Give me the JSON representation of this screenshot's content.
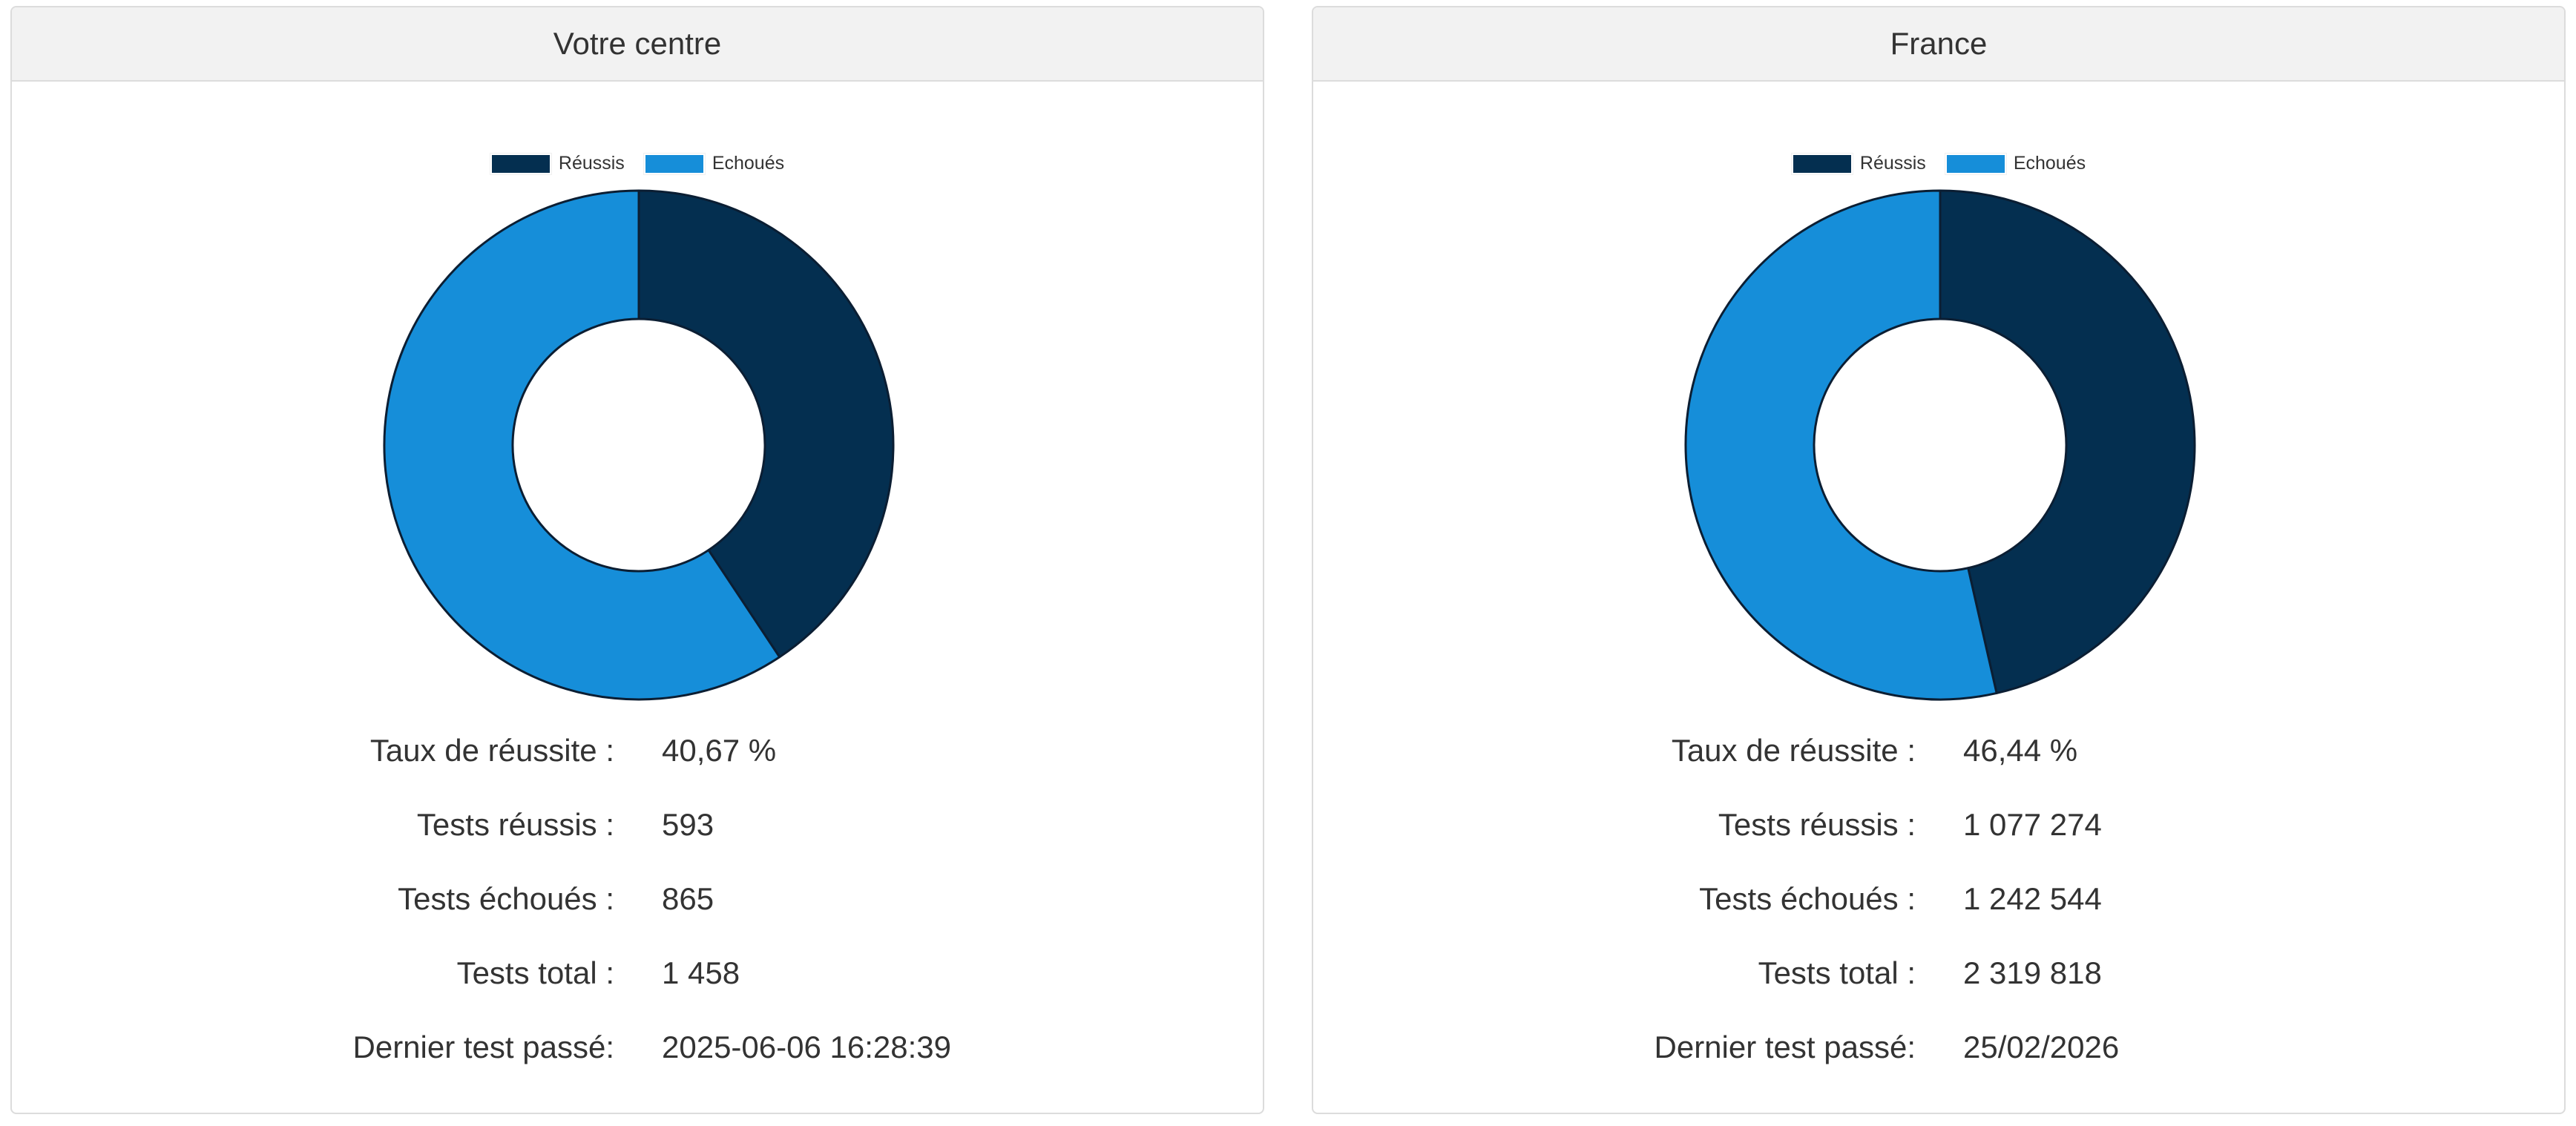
{
  "panels": [
    {
      "title": "Votre centre",
      "stats": [
        {
          "label": "Taux de réussite :",
          "value": "40,67 %"
        },
        {
          "label": "Tests réussis :",
          "value": "593"
        },
        {
          "label": "Tests échoués :",
          "value": "865"
        },
        {
          "label": "Tests total :",
          "value": "1 458"
        },
        {
          "label": "Dernier test passé:",
          "value": "2025-06-06 16:28:39"
        }
      ]
    },
    {
      "title": "France",
      "stats": [
        {
          "label": "Taux de réussite :",
          "value": "46,44 %"
        },
        {
          "label": "Tests réussis :",
          "value": "1 077 274"
        },
        {
          "label": "Tests échoués :",
          "value": "1 242 544"
        },
        {
          "label": "Tests total :",
          "value": "2 319 818"
        },
        {
          "label": "Dernier test passé:",
          "value": "25/02/2026"
        }
      ]
    }
  ],
  "colors": {
    "success": "#042f50",
    "failed": "#168ed9",
    "outline": "#0b1e33"
  },
  "chart_data": [
    {
      "type": "pie",
      "categories": [
        "Réussis",
        "Echoués"
      ],
      "values": [
        593,
        865
      ],
      "legend": "top-center"
    },
    {
      "type": "pie",
      "categories": [
        "Réussis",
        "Echoués"
      ],
      "values": [
        1077274,
        1242544
      ],
      "legend": "top-center"
    }
  ]
}
